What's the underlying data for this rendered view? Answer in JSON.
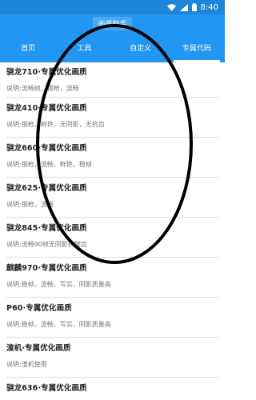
{
  "status": {
    "time": "8:40"
  },
  "header": {
    "title": "画质助手"
  },
  "tabs": [
    {
      "label": "首页",
      "active": false
    },
    {
      "label": "工具",
      "active": false
    },
    {
      "label": "自定义",
      "active": false
    },
    {
      "label": "专属代码",
      "active": true
    }
  ],
  "items": [
    {
      "title": "骁龙710·专属优化画质",
      "desc": "说明:流畅帧，钢枪，流畅"
    },
    {
      "title": "骁龙410·专属优化画质",
      "desc": "说明:钢枪，鲜艳，无阴影，无抗齿"
    },
    {
      "title": "骁龙660·专属优化画质",
      "desc": "说明:钢枪，流畅，鲜艳，稳帧"
    },
    {
      "title": "骁龙625·专属优化画质",
      "desc": "说明:钢枪，流畅"
    },
    {
      "title": "骁龙845·专属优化画质",
      "desc": "说明:流畅90帧无阴影抗锯齿"
    },
    {
      "title": "麒麟970·专属优化画质",
      "desc": "说明:稳帧，流畅，写实，阴影质量高"
    },
    {
      "title": "P60·专属优化画质",
      "desc": "说明:稳帧，流畅，写实，阴影质量高"
    },
    {
      "title": "渣机·专属优化画质",
      "desc": "说明:渣机使用"
    },
    {
      "title": "骁龙636·专属优化画质",
      "desc": ""
    }
  ],
  "colors": {
    "primary": "#2196f3",
    "statusbar": "#1e86d8"
  }
}
